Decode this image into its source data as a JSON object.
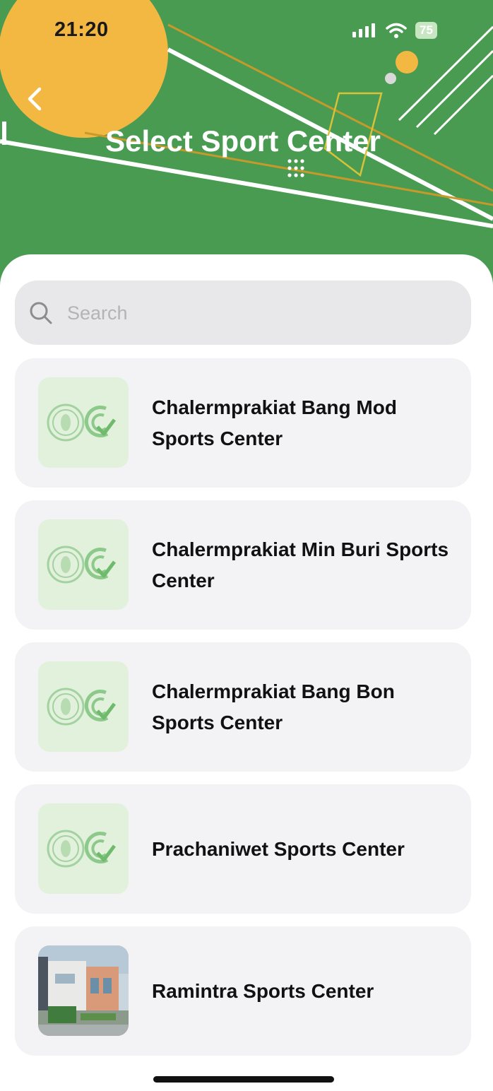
{
  "status_bar": {
    "time": "21:20",
    "battery": "75"
  },
  "header": {
    "title": "Select Sport Center"
  },
  "search": {
    "placeholder": "Search"
  },
  "centers": [
    {
      "name": "Chalermprakiat Bang Mod Sports Center",
      "thumbnail": "logo"
    },
    {
      "name": "Chalermprakiat Min Buri Sports Center",
      "thumbnail": "logo"
    },
    {
      "name": "Chalermprakiat Bang Bon Sports Center",
      "thumbnail": "logo"
    },
    {
      "name": "Prachaniwet Sports Center",
      "thumbnail": "logo"
    },
    {
      "name": "Ramintra Sports Center",
      "thumbnail": "photo"
    }
  ],
  "colors": {
    "header_green": "#4a9b52",
    "accent_yellow": "#f2b842",
    "card_bg": "#f3f3f6",
    "search_bg": "#e8e8ea"
  }
}
